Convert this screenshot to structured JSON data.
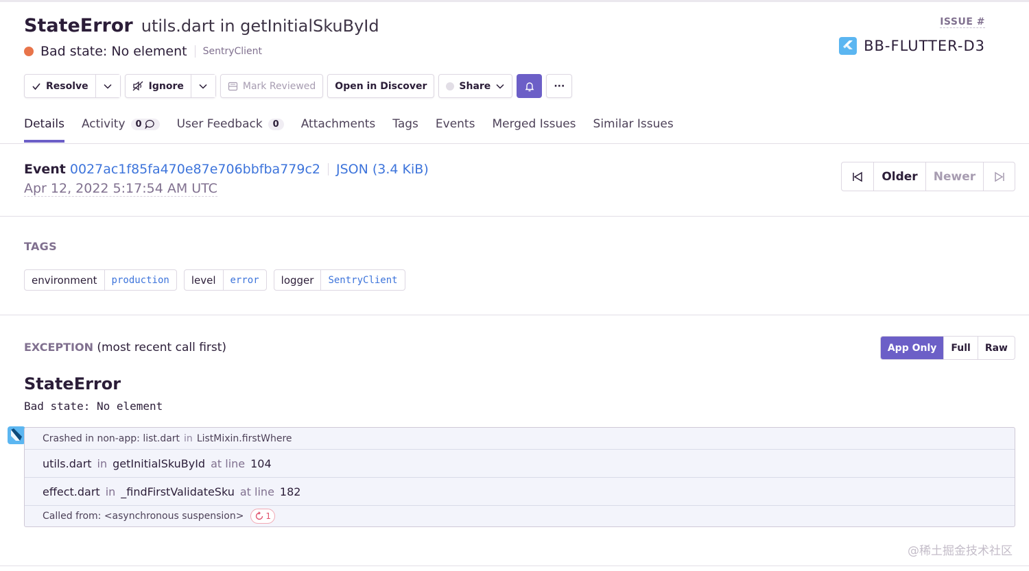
{
  "issue": {
    "title": "StateError",
    "subtitle": "utils.dart in getInitialSkuById",
    "message": "Bad state: No element",
    "culprit": "SentryClient",
    "id_label": "ISSUE #",
    "short_id": "BB-FLUTTER-D3"
  },
  "actions": {
    "resolve": "Resolve",
    "ignore": "Ignore",
    "mark_reviewed": "Mark Reviewed",
    "open_discover": "Open in Discover",
    "share": "Share",
    "more": "···"
  },
  "tabs": [
    {
      "label": "Details"
    },
    {
      "label": "Activity",
      "badge": "0"
    },
    {
      "label": "User Feedback",
      "badge": "0"
    },
    {
      "label": "Attachments"
    },
    {
      "label": "Tags"
    },
    {
      "label": "Events"
    },
    {
      "label": "Merged Issues"
    },
    {
      "label": "Similar Issues"
    }
  ],
  "event": {
    "label": "Event",
    "id": "0027ac1f85fa470e87e706bbfba779c2",
    "json_link": "JSON (3.4 KiB)",
    "date": "Apr 12, 2022 5:17:54 AM UTC"
  },
  "pager": {
    "older": "Older",
    "newer": "Newer"
  },
  "tags_section": {
    "title": "TAGS",
    "items": [
      {
        "key": "environment",
        "value": "production"
      },
      {
        "key": "level",
        "value": "error"
      },
      {
        "key": "logger",
        "value": "SentryClient"
      }
    ]
  },
  "exception": {
    "title_upper": "EXCEPTION",
    "title_rest": "(most recent call first)",
    "view_options": [
      "App Only",
      "Full",
      "Raw"
    ],
    "type": "StateError",
    "value": "Bad state: No element",
    "frames": {
      "crashed": {
        "prefix": "Crashed in non-app: list.dart",
        "in": "in",
        "func": "ListMixin.firstWhere"
      },
      "frame1": {
        "file": "utils.dart",
        "in": "in",
        "func": "getInitialSkuById",
        "at": "at line",
        "line": "104"
      },
      "frame2": {
        "file": "effect.dart",
        "in": "in",
        "func": "_findFirstValidateSku",
        "at": "at line",
        "line": "182"
      },
      "called_from": "Called from: <asynchronous suspension>",
      "recursion_count": "1"
    }
  },
  "watermark": "@稀土掘金技术社区",
  "colors": {
    "accent": "#6c5fc7",
    "link": "#3d74db",
    "error_dot": "#e8744a"
  }
}
